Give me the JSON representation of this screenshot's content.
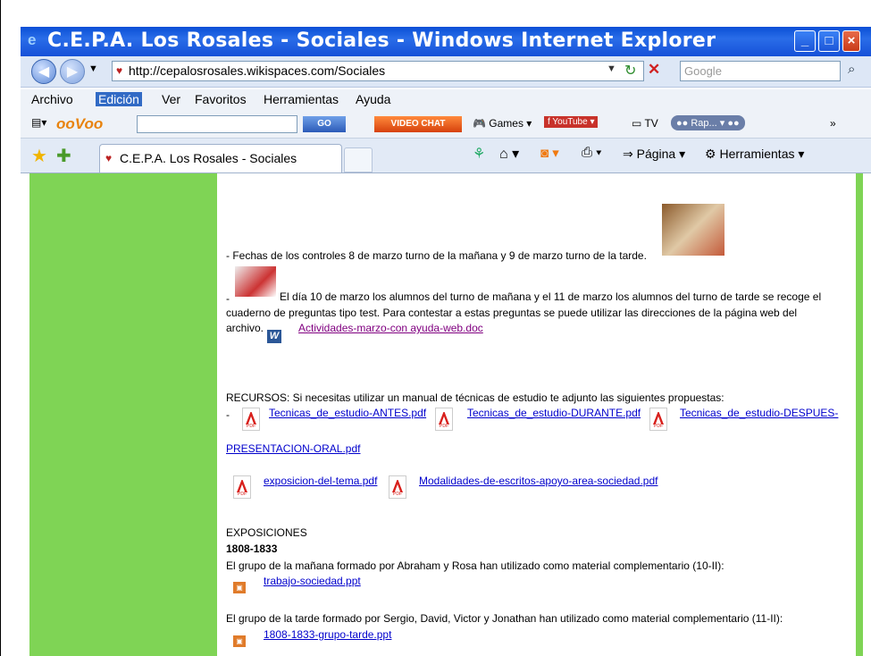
{
  "window": {
    "title": "C.E.P.A. Los Rosales - Sociales - Windows Internet Explorer"
  },
  "address_bar": {
    "url": "http://cepalosrosales.wikispaces.com/Sociales",
    "search_placeholder": "Google"
  },
  "menu": [
    "Archivo",
    "Edición",
    "Ver",
    "Favoritos",
    "Herramientas",
    "Ayuda"
  ],
  "toolbar": {
    "logo": "ooVoo",
    "go": "GO",
    "video_chat": "VIDEO CHAT",
    "games": "Games",
    "tv": "TV",
    "radio": "Rap..."
  },
  "tab": {
    "label": "C.E.P.A. Los Rosales - Sociales"
  },
  "command_bar": {
    "page": "Página",
    "tools": "Herramientas"
  },
  "content": {
    "fechas": "- Fechas de los controles 8 de marzo turno de la mañana y 9 de marzo turno de la tarde.",
    "dia10_line1": "El día 10 de marzo los alumnos del turno de mañana y el 11 de marzo los alumnos del turno de tarde se recoge el",
    "dia10_line2": "cuaderno de preguntas tipo test. Para contestar a estas preguntas se puede utilizar las direcciones de la página web del",
    "dia10_line3": "archivo.",
    "doc_link": "Actividades-marzo-con ayuda-web.doc",
    "recursos": "RECURSOS: Si necesitas utilizar un manual de técnicas de estudio te adjunto las siguientes propuestas:",
    "pdf1": "Tecnicas_de_estudio-ANTES.pdf",
    "pdf2": "Tecnicas_de_estudio-DURANTE.pdf",
    "pdf3a": "Tecnicas_de_estudio-DESPUES-",
    "pdf3b": "PRESENTACION-ORAL.pdf",
    "pdf4": "exposicion-del-tema.pdf",
    "pdf5": "Modalidades-de-escritos-apoyo-area-sociedad.pdf",
    "exposiciones": "EXPOSICIONES",
    "periodo": "1808-1833",
    "grupo_manana": "El grupo de la mañana formado por Abraham y Rosa han utilizado como material complementario (10-II):",
    "ppt1": "trabajo-sociedad.ppt",
    "grupo_tarde": "El grupo de la tarde formado por Sergio, David, Victor y Jonathan han utilizado como material complementario (11-II):",
    "ppt2": "1808-1833-grupo-tarde.ppt"
  }
}
